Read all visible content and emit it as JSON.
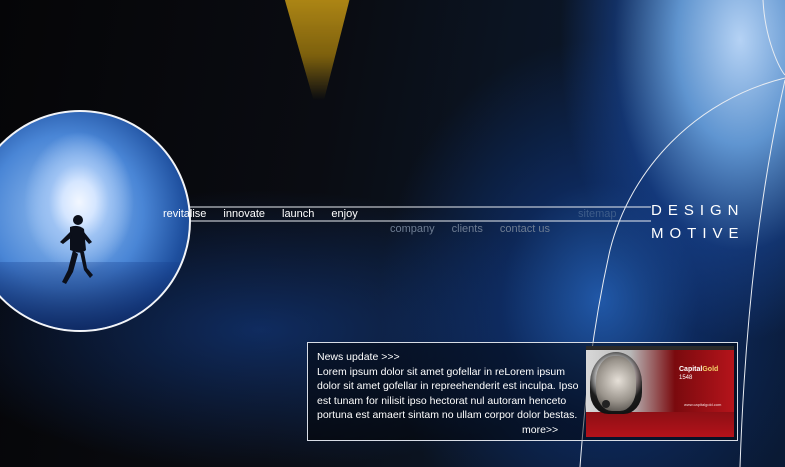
{
  "main_nav": [
    "revitalise",
    "innovate",
    "launch",
    "enjoy"
  ],
  "sub_nav": [
    "company",
    "clients",
    "contact us"
  ],
  "sitemap_label": "sitemap",
  "brand": {
    "line1": "DESIGN",
    "line2": "MOTIVE"
  },
  "news": {
    "heading": "News update >>>",
    "body": "Lorem ipsum dolor sit amet gofellar in reLorem ipsum dolor sit amet gofellar in repreehenderit est inculpa. Ipso est tunam for nilisit ipso hectorat nul autoram henceto portuna est amaert sintam no ullam corpor dolor bestas.",
    "more_label": "more>>"
  },
  "billboard": {
    "brand_a": "Capital",
    "brand_b": "Gold",
    "frequency": "1548",
    "url": "www.capitalgold.com"
  },
  "colors": {
    "sub_nav_text": "#6d7c92",
    "sitemap_text": "#3e5d8a",
    "line": "#e8ecf2"
  },
  "icons": {
    "hero": "running-figure",
    "photo": "singer-billboard"
  }
}
